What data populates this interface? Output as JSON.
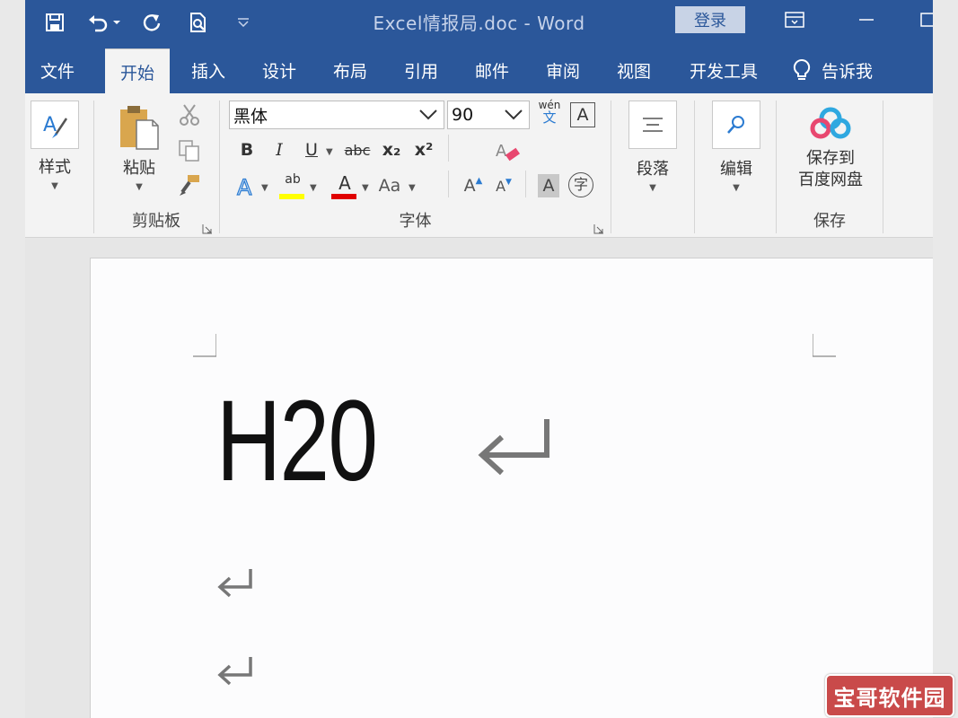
{
  "window": {
    "title": "Excel情报局.doc  -  Word",
    "login_label": "登录"
  },
  "tabs": [
    "文件",
    "开始",
    "插入",
    "设计",
    "布局",
    "引用",
    "邮件",
    "审阅",
    "视图",
    "开发工具"
  ],
  "active_tab": "开始",
  "tell_me": "告诉我",
  "ribbon": {
    "styles": {
      "label": "样式"
    },
    "clipboard": {
      "paste_label": "粘贴",
      "group_label": "剪贴板"
    },
    "font": {
      "font_name": "黑体",
      "font_size": "90",
      "group_label": "字体",
      "bold": "B",
      "italic": "I",
      "underline": "U",
      "strikethrough": "abc",
      "subscript": "x₂",
      "superscript": "x²",
      "phonetic_top": "wén",
      "phonetic_bottom": "文",
      "char_border": "A",
      "highlight_text": "ab",
      "font_color_text": "A",
      "change_case": "Aa",
      "grow_font": "A",
      "shrink_font": "A",
      "char_shading": "A",
      "enclose_char": "字"
    },
    "paragraph": {
      "label": "段落"
    },
    "editing": {
      "label": "编辑"
    },
    "save": {
      "line1": "保存到",
      "line2": "百度网盘",
      "group_label": "保存"
    }
  },
  "document": {
    "text": "H20"
  },
  "watermark": "宝哥软件园",
  "colors": {
    "title_bar": "#2b579a",
    "ribbon": "#f3f3f3",
    "highlight_yellow": "#ffff00",
    "font_color_red": "#e00000"
  }
}
